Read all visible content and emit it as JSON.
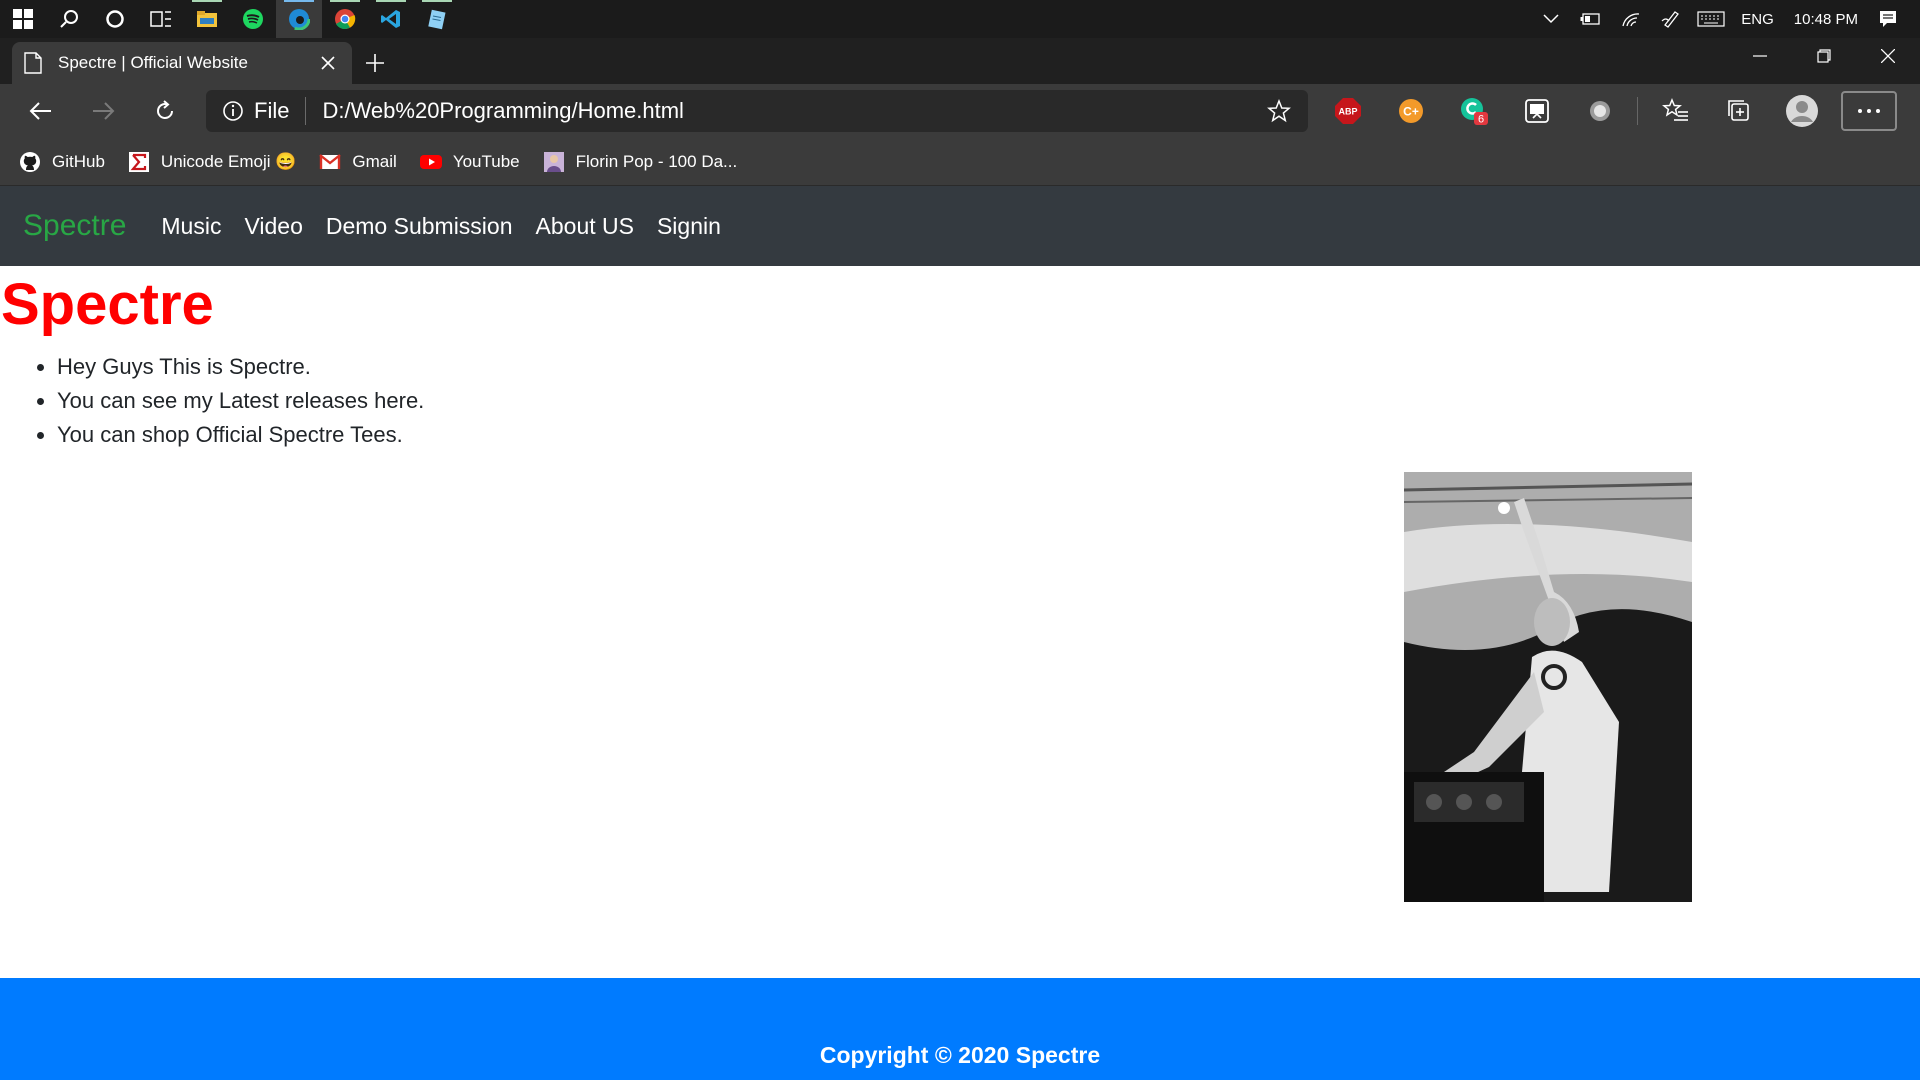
{
  "taskbar": {
    "apps": [
      {
        "name": "start-button"
      },
      {
        "name": "search-button"
      },
      {
        "name": "cortana-button"
      },
      {
        "name": "task-view-button"
      },
      {
        "name": "file-explorer-app"
      },
      {
        "name": "spotify-app"
      },
      {
        "name": "edge-app"
      },
      {
        "name": "chrome-app"
      },
      {
        "name": "vscode-app"
      },
      {
        "name": "notepad-app"
      }
    ],
    "language": "ENG",
    "time": "10:48 PM"
  },
  "browser": {
    "tab_title": "Spectre | Official Website",
    "scheme_label": "File",
    "url": "D:/Web%20Programming/Home.html",
    "extensions": [
      "ABP",
      "C+",
      "6"
    ],
    "bookmarks": [
      {
        "label": "GitHub",
        "icon": "github-icon"
      },
      {
        "label": "Unicode Emoji 😄",
        "icon": "unicode-icon"
      },
      {
        "label": "Gmail",
        "icon": "gmail-icon"
      },
      {
        "label": "YouTube",
        "icon": "youtube-icon"
      },
      {
        "label": "Florin Pop - 100 Da...",
        "icon": "avatar-icon"
      }
    ]
  },
  "site": {
    "brand": "Spectre",
    "nav": [
      "Music",
      "Video",
      "Demo Submission",
      "About US",
      "Signin"
    ],
    "heading": "Spectre",
    "bullets": [
      "Hey Guys This is Spectre.",
      "You can see my Latest releases here.",
      "You can shop Official Spectre Tees."
    ],
    "footer": "Copyright © 2020 Spectre",
    "colors": {
      "brand": "#28a745",
      "heading": "#ff0000",
      "navbar": "#343a40",
      "footer": "#007bff"
    }
  }
}
